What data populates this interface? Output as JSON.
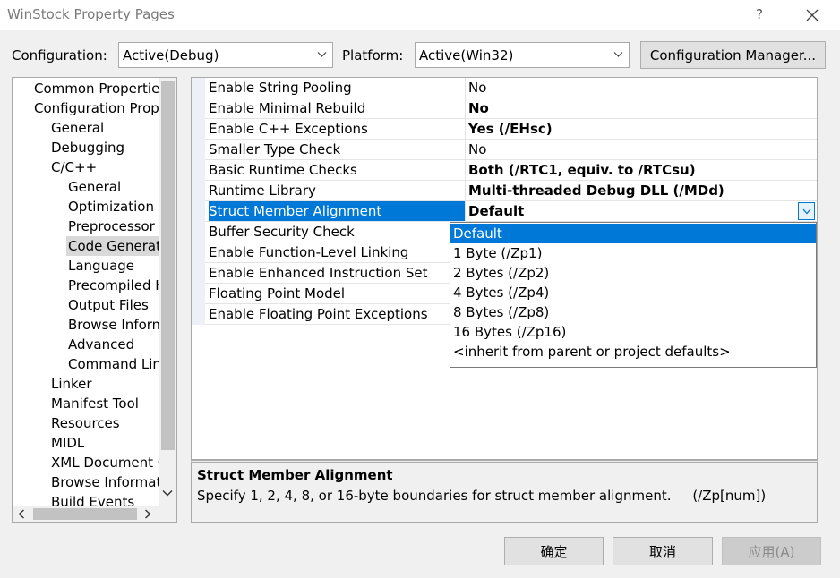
{
  "window": {
    "title": "WinStock Property Pages",
    "help": "?",
    "close_icon": "close-icon"
  },
  "config": {
    "configuration_label": "Configuration:",
    "configuration_value": "Active(Debug)",
    "platform_label": "Platform:",
    "platform_value": "Active(Win32)",
    "manager_button": "Configuration Manager..."
  },
  "tree": {
    "items": [
      "Common Properties",
      "Configuration Properties",
      "General",
      "Debugging",
      "C/C++",
      "General",
      "Optimization",
      "Preprocessor",
      "Code Generation",
      "Language",
      "Precompiled Headers",
      "Output Files",
      "Browse Information",
      "Advanced",
      "Command Line",
      "Linker",
      "Manifest Tool",
      "Resources",
      "MIDL",
      "XML Document Generator",
      "Browse Information",
      "Build Events"
    ],
    "selected_index": 8
  },
  "grid": {
    "rows": [
      {
        "name": "Enable String Pooling",
        "value": "No"
      },
      {
        "name": "Enable Minimal Rebuild",
        "value": "No"
      },
      {
        "name": "Enable C++ Exceptions",
        "value": "Yes (/EHsc)"
      },
      {
        "name": "Smaller Type Check",
        "value": "No"
      },
      {
        "name": "Basic Runtime Checks",
        "value": "Both (/RTC1, equiv. to /RTCsu)"
      },
      {
        "name": "Runtime Library",
        "value": "Multi-threaded Debug DLL (/MDd)"
      },
      {
        "name": "Struct Member Alignment",
        "value": "Default"
      },
      {
        "name": "Buffer Security Check",
        "value": ""
      },
      {
        "name": "Enable Function-Level Linking",
        "value": ""
      },
      {
        "name": "Enable Enhanced Instruction Set",
        "value": ""
      },
      {
        "name": "Floating Point Model",
        "value": ""
      },
      {
        "name": "Enable Floating Point Exceptions",
        "value": ""
      }
    ]
  },
  "dropdown": {
    "options": [
      "Default",
      "1 Byte (/Zp1)",
      "2 Bytes (/Zp2)",
      "4 Bytes (/Zp4)",
      "8 Bytes (/Zp8)",
      "16 Bytes (/Zp16)",
      "<inherit from parent or project defaults>"
    ],
    "selected_index": 0
  },
  "description": {
    "title": "Struct Member Alignment",
    "text": "Specify 1, 2, 4, 8, or 16-byte boundaries for struct member alignment.     (/Zp[num])"
  },
  "buttons": {
    "ok": "确定",
    "cancel": "取消",
    "apply": "应用(A)"
  },
  "colors": {
    "selection": "#0078d7",
    "background": "#f0f0f0"
  }
}
